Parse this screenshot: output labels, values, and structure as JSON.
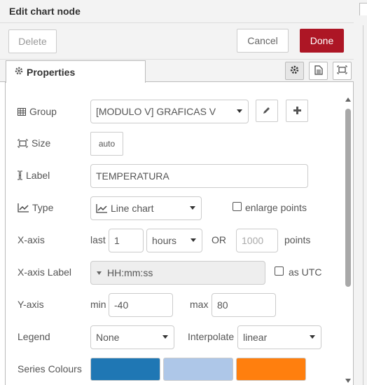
{
  "tray": {
    "title": "Edit chart node",
    "delete_label": "Delete",
    "cancel_label": "Cancel",
    "done_label": "Done",
    "tab_label": "Properties"
  },
  "form": {
    "group": {
      "label": "Group",
      "value": "[MODULO V] GRAFICAS V"
    },
    "size": {
      "label": "Size",
      "value": "auto"
    },
    "name": {
      "label": "Label",
      "value": "TEMPERATURA"
    },
    "type": {
      "label": "Type",
      "value": "Line chart",
      "enlarge_label": "enlarge points",
      "enlarge_checked": false
    },
    "xaxis": {
      "label": "X-axis",
      "last_label": "last",
      "last_value": "1",
      "unit_value": "hours",
      "or_label": "OR",
      "points_placeholder": "1000",
      "points_label": "points"
    },
    "xaxis_label": {
      "label": "X-axis Label",
      "value": "HH:mm:ss",
      "utc_label": "as UTC",
      "utc_checked": false
    },
    "yaxis": {
      "label": "Y-axis",
      "min_label": "min",
      "min_value": "-40",
      "max_label": "max",
      "max_value": "80"
    },
    "legend": {
      "label": "Legend",
      "value": "None",
      "interpolate_label": "Interpolate",
      "interpolate_value": "linear"
    },
    "colours": {
      "label": "Series Colours",
      "swatches": [
        "#1f77b4",
        "#aec7e8",
        "#ff7f0e"
      ]
    }
  },
  "colors": {
    "done": "#ad1625",
    "accent": "#ad1625"
  }
}
